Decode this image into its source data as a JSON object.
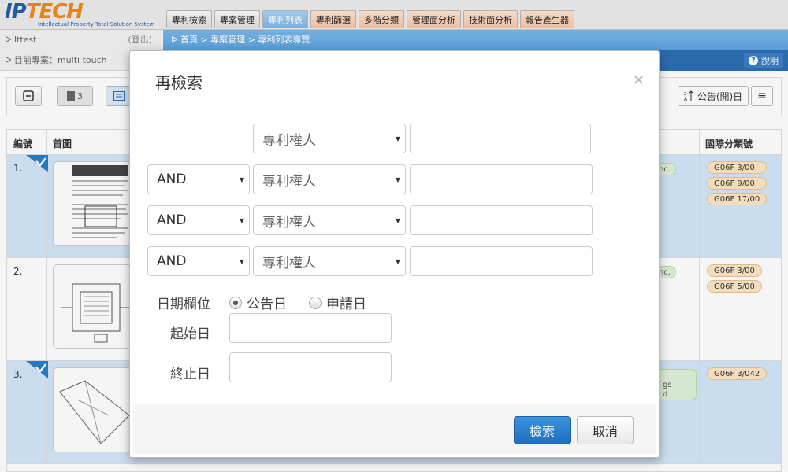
{
  "app": {
    "logo_text_ip": "IP",
    "logo_text_tech": "TECH",
    "logo_subtitle": "Intellectual Property Total Solution System"
  },
  "nav": {
    "tabs": [
      {
        "label": "專利檢索"
      },
      {
        "label": "專案管理"
      },
      {
        "label": "專利列表"
      },
      {
        "label": "專利篩選"
      },
      {
        "label": "多階分類"
      },
      {
        "label": "管理面分析"
      },
      {
        "label": "技術面分析"
      },
      {
        "label": "報告產生器"
      }
    ]
  },
  "user": {
    "name": "lttest",
    "logout": "(登出)",
    "project_label": "目前專案：multi touch"
  },
  "breadcrumb": "首頁 > 專案管理 > 專利列表導覽",
  "help_label": "說明",
  "toolbar": {
    "count": "3",
    "sort_label": "公告(開)日"
  },
  "table": {
    "col_num": "編號",
    "col_image": "首圖",
    "col_ipc": "國際分類號",
    "rows": [
      {
        "num": "1.",
        "green": "Inc.",
        "tags": [
          "G06F 3/00",
          "G06F 9/00",
          "G06F 17/00"
        ]
      },
      {
        "num": "2.",
        "green": "Inc.",
        "tags": [
          "G06F 3/00",
          "G06F 5/00"
        ]
      },
      {
        "num": "3.",
        "green_l1": "gs",
        "green_l2": "d",
        "tags": [
          "G06F 3/042"
        ]
      }
    ]
  },
  "modal": {
    "title": "再檢索",
    "close": "×",
    "field_default": "專利權人",
    "op_default": "AND",
    "date_field_label": "日期欄位",
    "radio_publish": "公告日",
    "radio_apply": "申請日",
    "start_label": "起始日",
    "end_label": "終止日",
    "search_btn": "檢索",
    "cancel_btn": "取消"
  }
}
